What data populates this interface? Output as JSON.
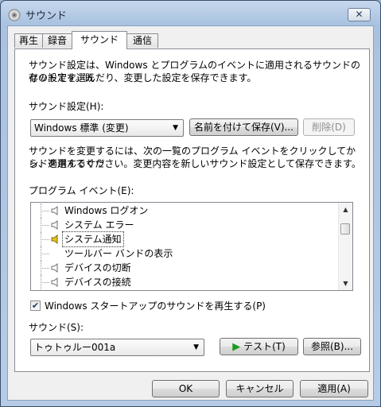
{
  "window": {
    "title": "サウンド",
    "close_glyph": "✕"
  },
  "tabs": [
    {
      "label": "再生"
    },
    {
      "label": "録音"
    },
    {
      "label": "サウンド",
      "active": true
    },
    {
      "label": "通信"
    }
  ],
  "intro_text_1": "サウンド設定は、Windows とプログラムのイベントに適用されるサウンドのセットです。既",
  "intro_text_2": "存の設定を選んだり、変更した設定を保存できます。",
  "scheme": {
    "label": "サウンド設定(H):",
    "selected": "Windows 標準 (変更)",
    "save_as_label": "名前を付けて保存(V)...",
    "delete_label": "削除(D)"
  },
  "help_text_1": "サウンドを変更するには、次の一覧のプログラム イベントをクリックしてから、適用するサウ",
  "help_text_2": "ンドを選んでください。変更内容を新しいサウンド設定として保存できます。",
  "events": {
    "label": "プログラム イベント(E):",
    "items": [
      {
        "label": "Windows ログオン",
        "icon": "speaker-icon"
      },
      {
        "label": "システム エラー",
        "icon": "speaker-icon"
      },
      {
        "label": "システム通知",
        "icon": "speaker-active-icon",
        "selected": true
      },
      {
        "label": "ツールバー バンドの表示",
        "icon": ""
      },
      {
        "label": "デバイスの切断",
        "icon": "speaker-icon"
      },
      {
        "label": "デバイスの接続",
        "icon": "speaker-icon"
      }
    ]
  },
  "startup": {
    "label": "Windows スタートアップのサウンドを再生する(P)",
    "checked": true
  },
  "sound": {
    "label": "サウンド(S):",
    "selected": "トゥトゥルー001a",
    "test_label": "テスト(T)",
    "browse_label": "参照(B)..."
  },
  "footer": {
    "ok_label": "OK",
    "cancel_label": "キャンセル",
    "apply_label": "適用(A)"
  },
  "colors": {
    "accent_green": "#1e9a1e",
    "speaker_yellow": "#e6c21e"
  }
}
